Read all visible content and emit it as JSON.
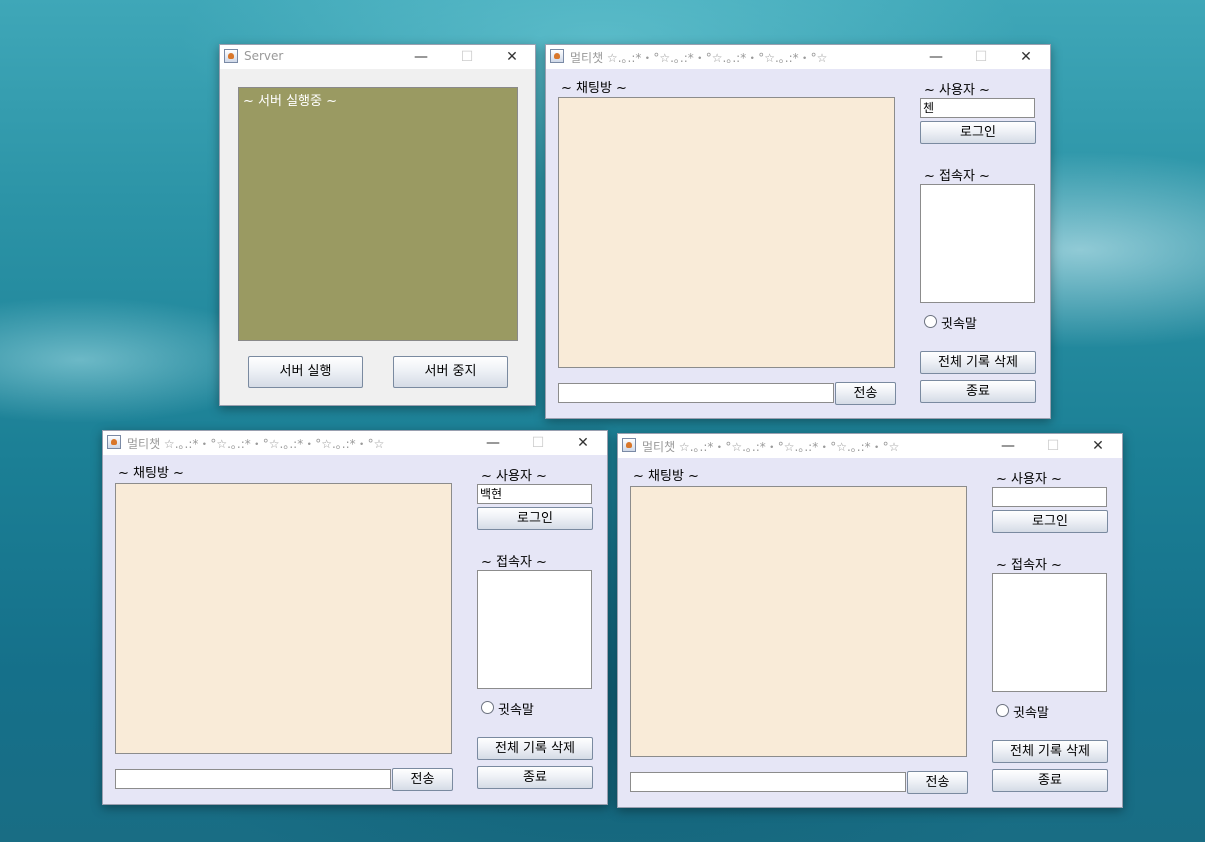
{
  "server": {
    "title": "Server",
    "log_text": "~ 서버 실행중 ~",
    "start_button": "서버 실행",
    "stop_button": "서버 중지"
  },
  "chat_windows": [
    {
      "title": "멀티챗 ☆.｡.:*・°☆.｡.:*・°☆.｡.:*・°☆.｡.:*・°☆",
      "chat_label": "~ 채팅방 ~",
      "user_label": "~ 사용자 ~",
      "username_value": "첸",
      "login_button": "로그인",
      "connected_label": "~ 접속자 ~",
      "whisper_label": "귓속말",
      "clear_button": "전체 기록 삭제",
      "exit_button": "종료",
      "send_button": "전송",
      "message_value": ""
    },
    {
      "title": "멀티챗 ☆.｡.:*・°☆.｡.:*・°☆.｡.:*・°☆.｡.:*・°☆",
      "chat_label": "~ 채팅방 ~",
      "user_label": "~ 사용자 ~",
      "username_value": "백현",
      "login_button": "로그인",
      "connected_label": "~ 접속자 ~",
      "whisper_label": "귓속말",
      "clear_button": "전체 기록 삭제",
      "exit_button": "종료",
      "send_button": "전송",
      "message_value": ""
    },
    {
      "title": "멀티챗 ☆.｡.:*・°☆.｡.:*・°☆.｡.:*・°☆.｡.:*・°☆",
      "chat_label": "~ 채팅방 ~",
      "user_label": "~ 사용자 ~",
      "username_value": "",
      "login_button": "로그인",
      "connected_label": "~ 접속자 ~",
      "whisper_label": "귓속말",
      "clear_button": "전체 기록 삭제",
      "exit_button": "종료",
      "send_button": "전송",
      "message_value": ""
    }
  ],
  "window_controls": {
    "minimize": "—",
    "maximize": "☐",
    "close": "✕"
  },
  "icons": {
    "window_icon": "java-app-icon"
  },
  "colors": {
    "chat_background": "#f9ebd8",
    "chat_window_background": "#e6e6f6",
    "server_log_background": "#9a9a62"
  }
}
